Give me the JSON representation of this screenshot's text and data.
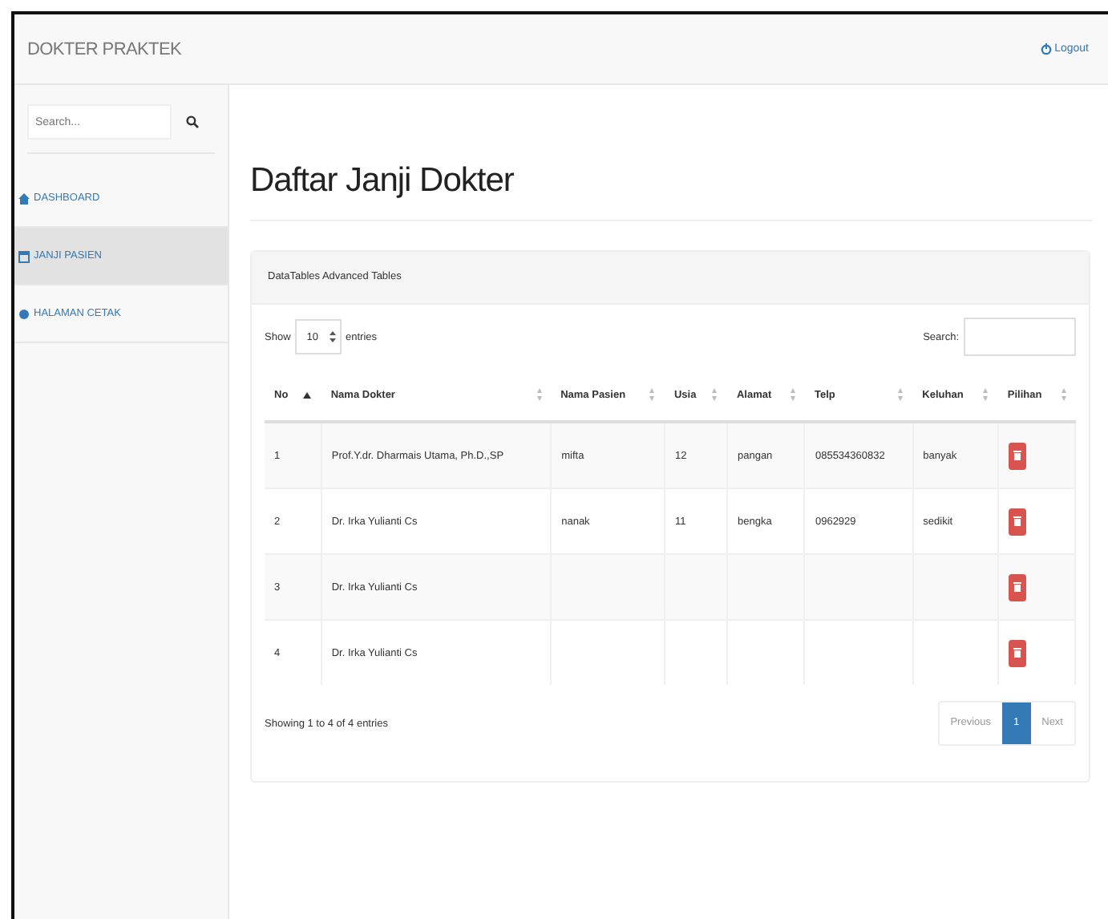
{
  "navbar": {
    "brand": "DOKTER PRAKTEK",
    "logout": "Logout"
  },
  "sidebar": {
    "search_placeholder": "Search...",
    "items": [
      {
        "label": "DASHBOARD",
        "selected": false
      },
      {
        "label": "JANJI PASIEN",
        "selected": true
      },
      {
        "label": "HALAMAN CETAK",
        "selected": false
      }
    ]
  },
  "page_title": "Daftar Janji Dokter",
  "panel": {
    "heading": "DataTables Advanced Tables",
    "length": {
      "prefix": "Show",
      "value": "10",
      "suffix": "entries"
    },
    "search_label": "Search:",
    "table": {
      "columns": [
        {
          "label": "No",
          "sorted": true
        },
        {
          "label": "Nama Dokter",
          "sorted": false
        },
        {
          "label": "Nama Pasien",
          "sorted": false
        },
        {
          "label": "Usia",
          "sorted": false
        },
        {
          "label": "Alamat",
          "sorted": false
        },
        {
          "label": "Telp",
          "sorted": false
        },
        {
          "label": "Keluhan",
          "sorted": false
        },
        {
          "label": "Pilihan",
          "sorted": false
        }
      ],
      "rows": [
        [
          "1",
          "Prof.Y.dr. Dharmais Utama, Ph.D.,SP",
          "mifta",
          "12",
          "pangan",
          "085534360832",
          "banyak"
        ],
        [
          "2",
          "Dr. Irka Yulianti Cs",
          "nanak",
          "11",
          "bengka",
          "0962929",
          "sedikit"
        ],
        [
          "3",
          "Dr. Irka Yulianti Cs",
          "",
          "",
          "",
          "",
          ""
        ],
        [
          "4",
          "Dr. Irka Yulianti Cs",
          "",
          "",
          "",
          "",
          ""
        ]
      ]
    },
    "info": "Showing 1 to 4 of 4 entries",
    "pagination": [
      {
        "label": "Previous",
        "kind": "prev",
        "selected": false
      },
      {
        "label": "1",
        "kind": "page",
        "selected": true
      },
      {
        "label": "Next",
        "kind": "next",
        "selected": false
      }
    ]
  }
}
